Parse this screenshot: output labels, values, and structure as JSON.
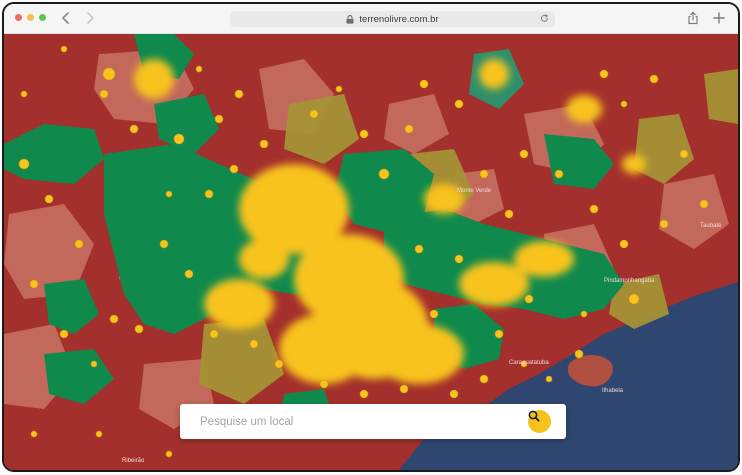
{
  "browser": {
    "url": "terrenolivre.com.br",
    "controls": [
      "close",
      "minimize",
      "zoom"
    ],
    "icons": [
      "chevron-left-icon",
      "chevron-right-icon",
      "lock-icon",
      "reload-icon",
      "share-icon",
      "plus-icon"
    ]
  },
  "map": {
    "type": "choropleth-with-markers",
    "region_colors": {
      "red": "#a3302c",
      "salmon": "#c46d5e",
      "green": "#0f8a4c",
      "olive": "#a59236",
      "teal": "#2f8f6b",
      "ocean": "#2f4770",
      "marker_yellow": "#f8c31e"
    },
    "legible_place_labels": [
      "Monte Verde",
      "Pindamonhangaba",
      "Taubaté",
      "Caraguatatuba",
      "Ilhabela",
      "Ribeirão"
    ]
  },
  "search": {
    "placeholder": "Pesquise um local",
    "value": "",
    "button_icon": "search-icon",
    "accent": "#f5c21b"
  }
}
